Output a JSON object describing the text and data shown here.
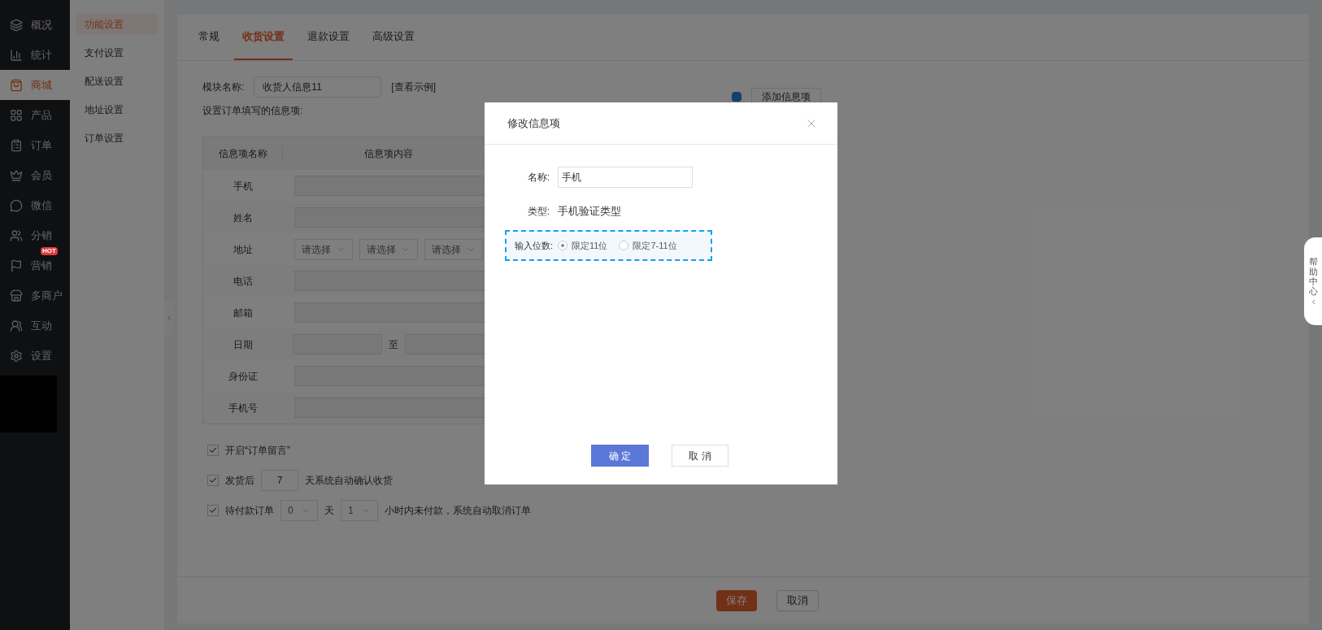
{
  "nav": {
    "items": [
      {
        "label": "概况",
        "selected": false
      },
      {
        "label": "统计",
        "selected": false
      },
      {
        "label": "商城",
        "selected": true
      },
      {
        "label": "产品",
        "selected": false
      },
      {
        "label": "订单",
        "selected": false
      },
      {
        "label": "会员",
        "selected": false
      },
      {
        "label": "微信",
        "selected": false
      },
      {
        "label": "分销",
        "selected": false
      },
      {
        "label": "营销",
        "selected": false,
        "badge": "HOT"
      },
      {
        "label": "多商户",
        "selected": false
      },
      {
        "label": "互动",
        "selected": false
      },
      {
        "label": "设置",
        "selected": false
      }
    ]
  },
  "subnav": {
    "items": [
      {
        "label": "功能设置",
        "selected": true
      },
      {
        "label": "支付设置",
        "selected": false
      },
      {
        "label": "配送设置",
        "selected": false
      },
      {
        "label": "地址设置",
        "selected": false
      },
      {
        "label": "订单设置",
        "selected": false
      }
    ]
  },
  "tabs": [
    {
      "label": "常规",
      "selected": false
    },
    {
      "label": "收货设置",
      "selected": true
    },
    {
      "label": "退款设置",
      "selected": false
    },
    {
      "label": "高级设置",
      "selected": false
    }
  ],
  "form": {
    "module_label": "模块名称:",
    "module_value": "收货人信息11",
    "example_link": "[查看示例]",
    "info_label": "设置订单填写的信息项:",
    "add_button": "添加信息项"
  },
  "table": {
    "columns": [
      "信息项名称",
      "信息项内容"
    ],
    "rows": [
      {
        "label": "手机",
        "kind": "text"
      },
      {
        "label": "姓名",
        "kind": "text"
      },
      {
        "label": "地址",
        "kind": "address",
        "selects": [
          "请选择",
          "请选择",
          "请选择"
        ]
      },
      {
        "label": "电话",
        "kind": "text"
      },
      {
        "label": "邮箱",
        "kind": "text"
      },
      {
        "label": "日期",
        "kind": "date",
        "separator": "至"
      },
      {
        "label": "身份证",
        "kind": "text"
      },
      {
        "label": "手机号",
        "kind": "text"
      }
    ]
  },
  "options": [
    {
      "kind": "plain",
      "checked": true,
      "text": "开启“订单留言”"
    },
    {
      "kind": "days",
      "checked": true,
      "before": "发货后",
      "value": "7",
      "after": "天系统自动确认收货"
    },
    {
      "kind": "timeout",
      "checked": true,
      "before": "待付款订单",
      "days": "0",
      "days_unit": "天",
      "hours": "1",
      "after": "小时内未付款，系统自动取消订单"
    }
  ],
  "footer": {
    "save": "保存",
    "cancel": "取消"
  },
  "modal": {
    "title": "修改信息项",
    "name_label": "名称:",
    "name_value": "手机",
    "type_label": "类型:",
    "type_value": "手机验证类型",
    "digits_label": "输入位数:",
    "radios": [
      {
        "label": "限定11位",
        "selected": true
      },
      {
        "label": "限定7-11位",
        "selected": false
      }
    ],
    "ok": "确 定",
    "cancel": "取 消"
  },
  "help_tab": "帮助中心"
}
